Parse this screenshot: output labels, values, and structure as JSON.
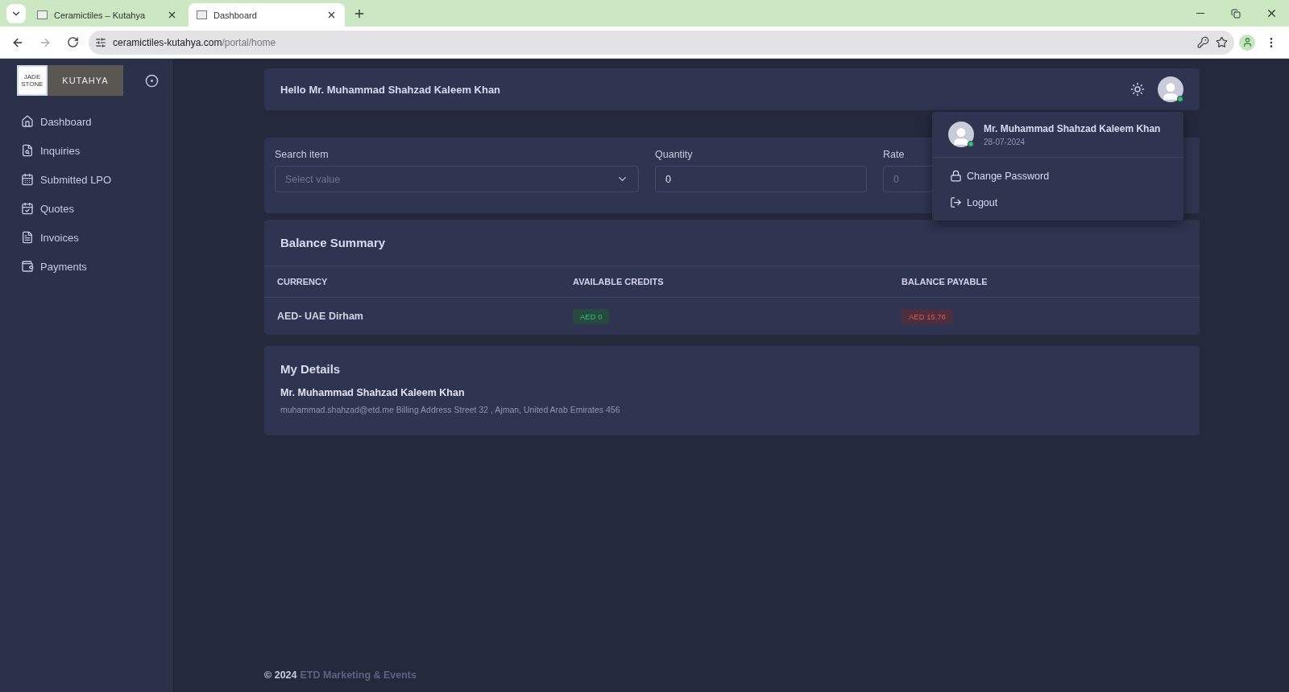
{
  "browser": {
    "tabs": [
      {
        "title": "Ceramictiles – Kutahya",
        "selected": false
      },
      {
        "title": "Dashboard",
        "selected": true
      }
    ],
    "url_host": "ceramictiles-kutahya.com",
    "url_path": "/portal/home"
  },
  "sidebar": {
    "logo": {
      "left": "JADE STONE",
      "right": "KUTAHYA"
    },
    "items": [
      {
        "label": "Dashboard"
      },
      {
        "label": "Inquiries"
      },
      {
        "label": "Submitted LPO"
      },
      {
        "label": "Quotes"
      },
      {
        "label": "Invoices"
      },
      {
        "label": "Payments"
      }
    ]
  },
  "header": {
    "greeting": "Hello Mr. Muhammad Shahzad Kaleem Khan",
    "online": true
  },
  "user_menu": {
    "name": "Mr. Muhammad Shahzad Kaleem Khan",
    "date": "28-07-2024",
    "items": [
      {
        "label": "Change Password"
      },
      {
        "label": "Logout"
      }
    ]
  },
  "form": {
    "search": {
      "label": "Search item",
      "placeholder": "Select value"
    },
    "quantity": {
      "label": "Quantity",
      "value": "0"
    },
    "rate": {
      "label": "Rate",
      "value": "0",
      "disabled": true
    }
  },
  "balance": {
    "title": "Balance Summary",
    "columns": [
      "CURRENCY",
      "AVAILABLE CREDITS",
      "BALANCE PAYABLE"
    ],
    "rows": [
      {
        "currency": "AED- UAE Dirham",
        "credits": "AED 0",
        "payable": "AED 15.76"
      }
    ]
  },
  "details": {
    "title": "My Details",
    "name": "Mr. Muhammad Shahzad Kaleem Khan",
    "info": "muhammad.shahzad@etd.me Billing Address Street 32 , Ajman, United Arab Emirates 456"
  },
  "footer": {
    "copyright": "© 2024",
    "company": "ETD Marketing & Events"
  }
}
